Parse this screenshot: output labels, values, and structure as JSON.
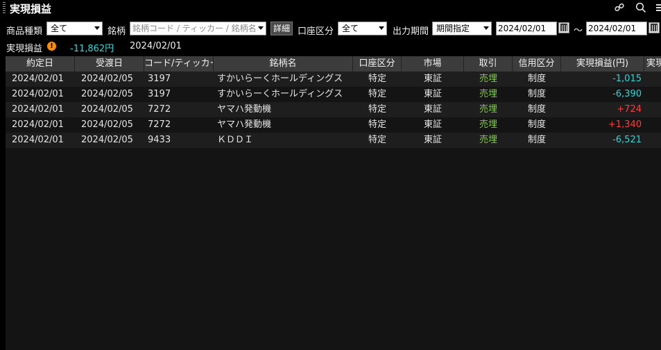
{
  "window": {
    "title": "実現損益",
    "icons": [
      "link-icon",
      "search-icon",
      "menu-icon"
    ]
  },
  "filters": {
    "product_type_label": "商品種類",
    "product_type_value": "全て",
    "symbol_label": "銘柄",
    "symbol_placeholder": "銘柄コード / ティッカー / 銘柄名",
    "detail_button": "詳細",
    "account_label": "口座区分",
    "account_value": "全て",
    "period_label": "出力期間",
    "period_value": "期間指定",
    "date_from": "2024/02/01",
    "range_sep": "～",
    "date_to": "2024/02/01"
  },
  "summary": {
    "label": "実現損益",
    "value": "-11,862円",
    "date": "2024/02/01"
  },
  "table": {
    "columns": [
      "約定日",
      "受渡日",
      "コード/ティッカー",
      "銘柄名",
      "口座区分",
      "市場",
      "取引",
      "信用区分",
      "実現損益(円)",
      "実現"
    ],
    "rows": [
      {
        "trade_date": "2024/02/01",
        "settle_date": "2024/02/05",
        "code": "3197",
        "name": "すかいらーくホールディングス",
        "account": "特定",
        "market": "東証",
        "trade": "売埋",
        "credit": "制度",
        "pl": "-1,015",
        "pl_sign": "neg"
      },
      {
        "trade_date": "2024/02/01",
        "settle_date": "2024/02/05",
        "code": "3197",
        "name": "すかいらーくホールディングス",
        "account": "特定",
        "market": "東証",
        "trade": "売埋",
        "credit": "制度",
        "pl": "-6,390",
        "pl_sign": "neg"
      },
      {
        "trade_date": "2024/02/01",
        "settle_date": "2024/02/05",
        "code": "7272",
        "name": "ヤマハ発動機",
        "account": "特定",
        "market": "東証",
        "trade": "売埋",
        "credit": "制度",
        "pl": "+724",
        "pl_sign": "pos"
      },
      {
        "trade_date": "2024/02/01",
        "settle_date": "2024/02/05",
        "code": "7272",
        "name": "ヤマハ発動機",
        "account": "特定",
        "market": "東証",
        "trade": "売埋",
        "credit": "制度",
        "pl": "+1,340",
        "pl_sign": "pos"
      },
      {
        "trade_date": "2024/02/01",
        "settle_date": "2024/02/05",
        "code": "9433",
        "name": "ＫＤＤＩ",
        "account": "特定",
        "market": "東証",
        "trade": "売埋",
        "credit": "制度",
        "pl": "-6,521",
        "pl_sign": "neg"
      }
    ]
  },
  "colors": {
    "negative": "#30d4d4",
    "positive": "#ff3c3c",
    "trade": "#7ccd3a",
    "warning": "#ff8c00"
  }
}
